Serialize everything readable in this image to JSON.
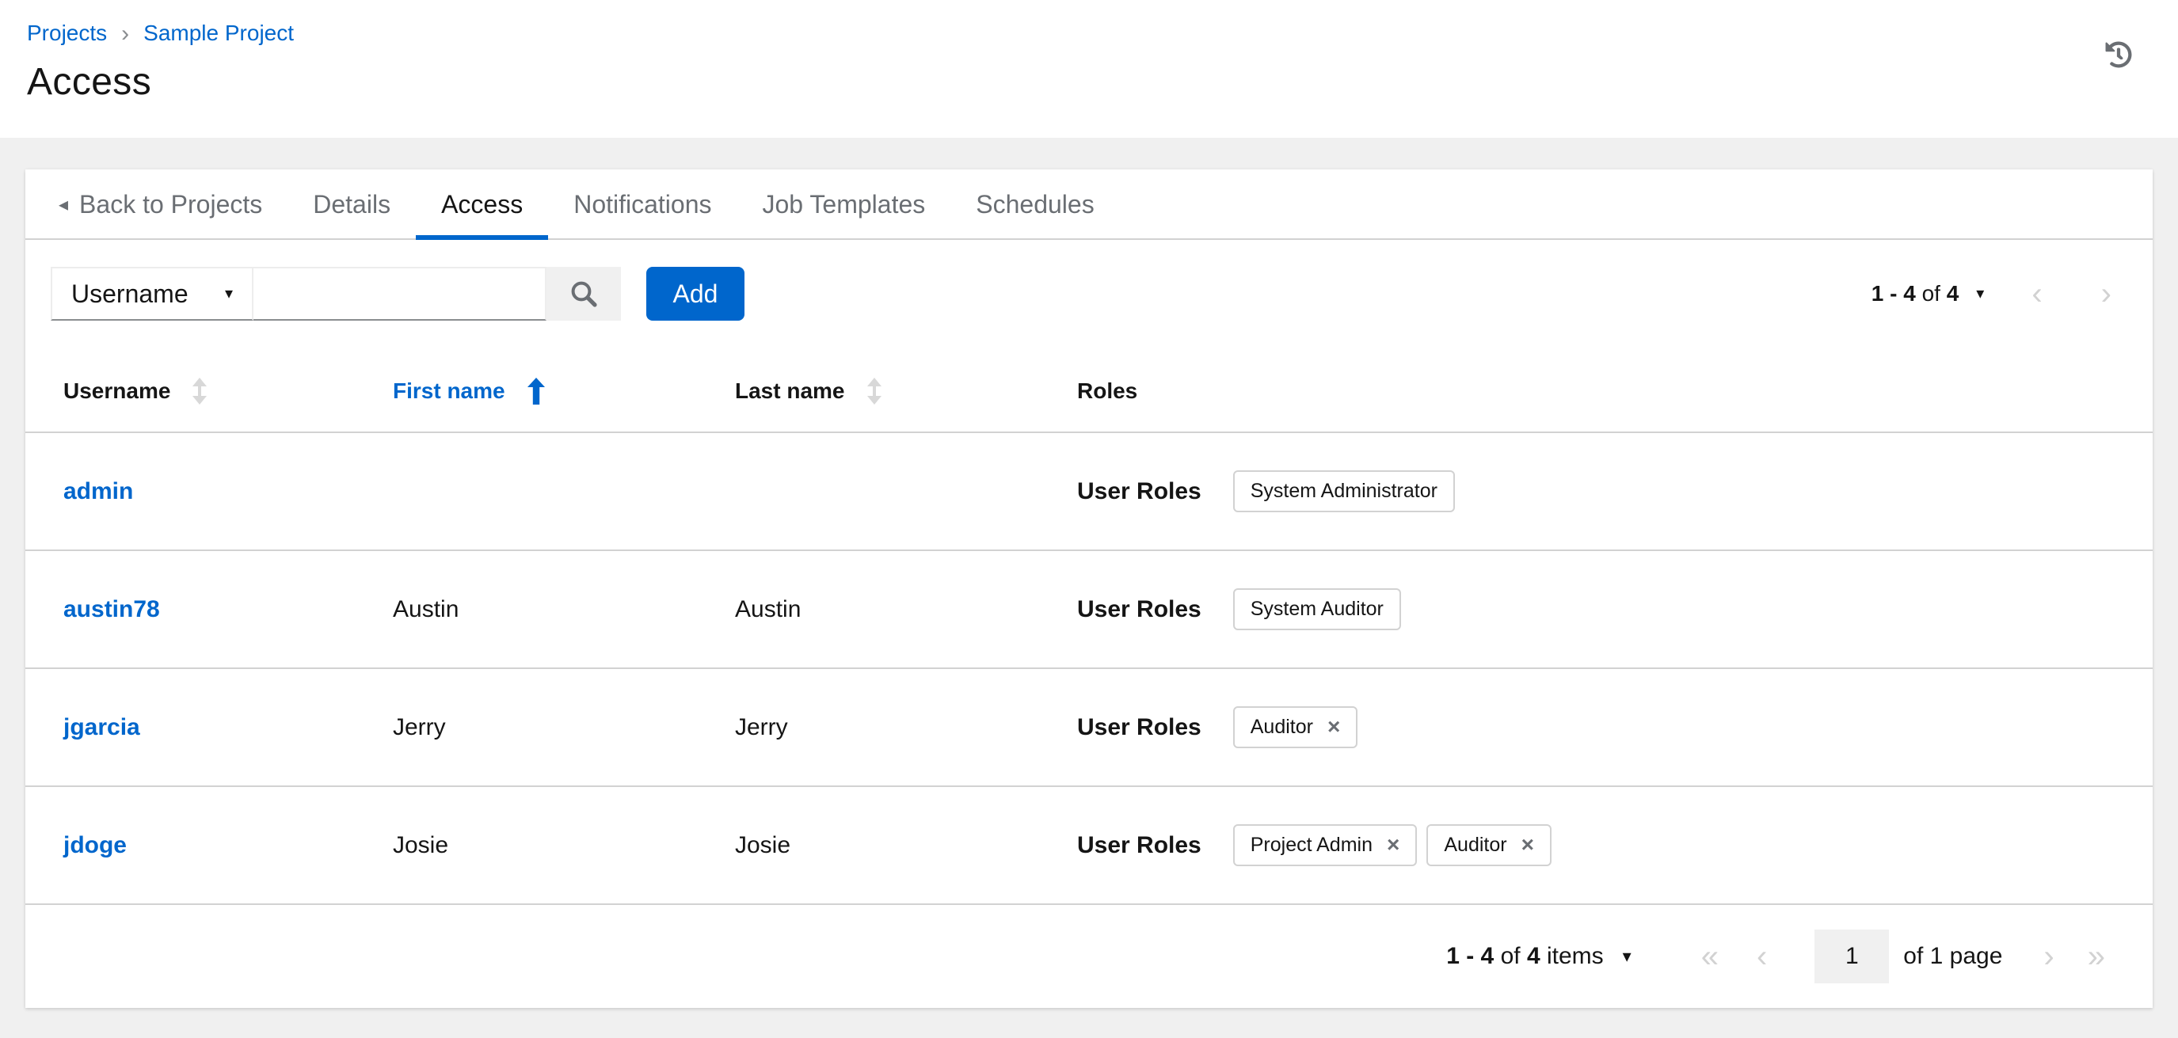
{
  "header": {
    "breadcrumb": [
      "Projects",
      "Sample Project"
    ],
    "title": "Access"
  },
  "icons": {
    "history": "history-icon",
    "search": "search-icon",
    "caret_down": "▾",
    "caret_left": "◂",
    "breadcrumb_separator": "›",
    "chip_remove": "×",
    "nav_first": "«",
    "nav_prev": "‹",
    "nav_next": "›",
    "nav_last": "»"
  },
  "tabs": {
    "back_label": "Back to Projects",
    "items": [
      {
        "label": "Details",
        "active": false
      },
      {
        "label": "Access",
        "active": true
      },
      {
        "label": "Notifications",
        "active": false
      },
      {
        "label": "Job Templates",
        "active": false
      },
      {
        "label": "Schedules",
        "active": false
      }
    ]
  },
  "toolbar": {
    "filter_select_value": "Username",
    "search_placeholder": "",
    "add_label": "Add",
    "pagination": {
      "range": "1 - 4",
      "of_label": "of",
      "total": "4"
    }
  },
  "table": {
    "columns": [
      {
        "label": "Username",
        "sortable": true,
        "sorted": null
      },
      {
        "label": "First name",
        "sortable": true,
        "sorted": "asc"
      },
      {
        "label": "Last name",
        "sortable": true,
        "sorted": null
      },
      {
        "label": "Roles",
        "sortable": false,
        "sorted": null
      }
    ],
    "row_roles_label": "User Roles",
    "rows": [
      {
        "username": "admin",
        "first_name": "",
        "last_name": "",
        "roles": [
          {
            "name": "System Administrator",
            "removable": false
          }
        ]
      },
      {
        "username": "austin78",
        "first_name": "Austin",
        "last_name": "Austin",
        "roles": [
          {
            "name": "System Auditor",
            "removable": false
          }
        ]
      },
      {
        "username": "jgarcia",
        "first_name": "Jerry",
        "last_name": "Jerry",
        "roles": [
          {
            "name": "Auditor",
            "removable": true
          }
        ]
      },
      {
        "username": "jdoge",
        "first_name": "Josie",
        "last_name": "Josie",
        "roles": [
          {
            "name": "Project Admin",
            "removable": true
          },
          {
            "name": "Auditor",
            "removable": true
          }
        ]
      }
    ]
  },
  "footer": {
    "range": "1 - 4",
    "of_label": "of",
    "total": "4",
    "items_label": "items",
    "page_value": "1",
    "page_of_label": "of 1 page"
  },
  "colors": {
    "primary": "#0066cc",
    "text": "#151515",
    "muted_text": "#6a6e73",
    "border": "#d2d2d2",
    "page_background": "#f0f0f0",
    "control_underline": "#8a8d90",
    "disabled_arrow": "#d2d2d2"
  }
}
